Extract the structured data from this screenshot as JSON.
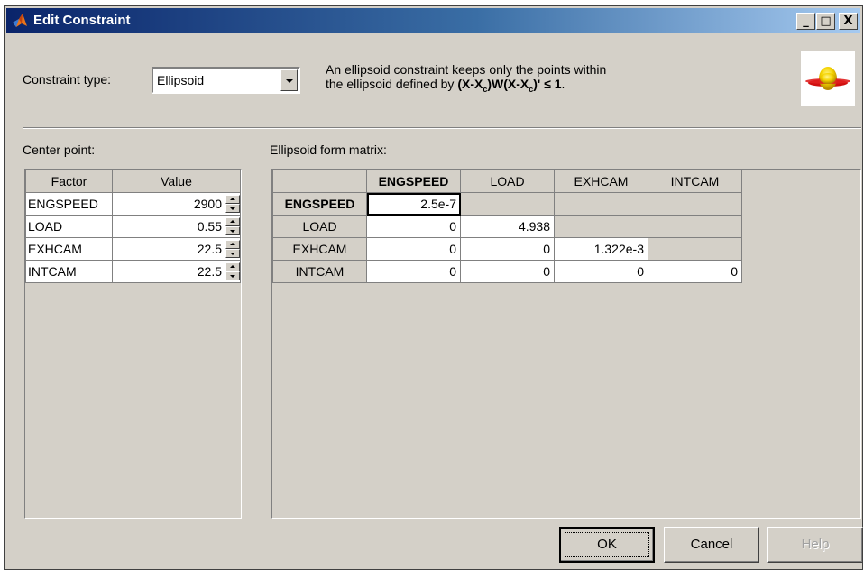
{
  "window": {
    "title": "Edit Constraint",
    "controls": {
      "minimize": "_",
      "maximize": "□",
      "close": "X"
    }
  },
  "constraint_type": {
    "label": "Constraint type:",
    "selected": "Ellipsoid"
  },
  "description": {
    "line1": "An ellipsoid constraint keeps only the points within",
    "line2_prefix": "the ellipsoid defined by",
    "formula": {
      "part1": "(X-X",
      "sub1": "c",
      "part2": ")W(X-X",
      "sub2": "c",
      "part3": ")' ≤ 1",
      "suffix": "."
    }
  },
  "center_point": {
    "label": "Center point:",
    "headers": {
      "factor": "Factor",
      "value": "Value"
    },
    "rows": [
      {
        "factor": "ENGSPEED",
        "value": "2900"
      },
      {
        "factor": "LOAD",
        "value": "0.55"
      },
      {
        "factor": "EXHCAM",
        "value": "22.5"
      },
      {
        "factor": "INTCAM",
        "value": "22.5"
      }
    ]
  },
  "matrix": {
    "label": "Ellipsoid form matrix:",
    "columns": [
      "ENGSPEED",
      "LOAD",
      "EXHCAM",
      "INTCAM"
    ],
    "rows": [
      {
        "name": "ENGSPEED",
        "values": [
          "2.5e-7",
          "",
          "",
          ""
        ]
      },
      {
        "name": "LOAD",
        "values": [
          "0",
          "4.938",
          "",
          ""
        ]
      },
      {
        "name": "EXHCAM",
        "values": [
          "0",
          "0",
          "1.322e-3",
          ""
        ]
      },
      {
        "name": "INTCAM",
        "values": [
          "0",
          "0",
          "0",
          "0"
        ]
      }
    ]
  },
  "buttons": {
    "ok": "OK",
    "cancel": "Cancel",
    "help": "Help"
  },
  "colors": {
    "dialog_bg": "#d4d0c8",
    "title_bar": "#0a246a",
    "icon_yellow": "#f5d400",
    "icon_red": "#d01010"
  }
}
